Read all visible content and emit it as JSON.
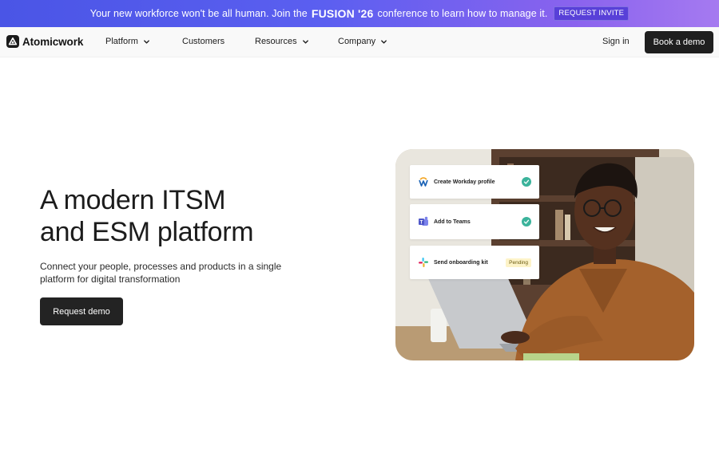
{
  "banner": {
    "text_before": "Your new workforce won't be all human. Join the",
    "brand": "FUSION '26",
    "text_after": "conference to learn how to manage it.",
    "cta": "REQUEST INVITE"
  },
  "nav": {
    "logo": "Atomicwork",
    "items": [
      {
        "label": "Platform",
        "has_dropdown": true
      },
      {
        "label": "Customers",
        "has_dropdown": false
      },
      {
        "label": "Resources",
        "has_dropdown": true
      },
      {
        "label": "Company",
        "has_dropdown": true
      }
    ],
    "sign_in": "Sign in",
    "cta": "Book a demo"
  },
  "hero": {
    "title_line1": "A modern ITSM",
    "title_line2": "and ESM platform",
    "subtitle": "Connect your people, processes and products in a single platform for digital transformation",
    "cta": "Request demo"
  },
  "tasks": [
    {
      "label": "Create Workday profile",
      "icon": "workday-icon",
      "status": "done"
    },
    {
      "label": "Add to Teams",
      "icon": "teams-icon",
      "status": "done"
    },
    {
      "label": "Send onboarding kit",
      "icon": "slack-icon",
      "status": "Pending"
    }
  ],
  "colors": {
    "banner_start": "#4a55e6",
    "banner_end": "#a57af0",
    "primary_button": "#1f1f1f",
    "check_green": "#3bb39b",
    "pending_bg": "#fdf3c8"
  }
}
